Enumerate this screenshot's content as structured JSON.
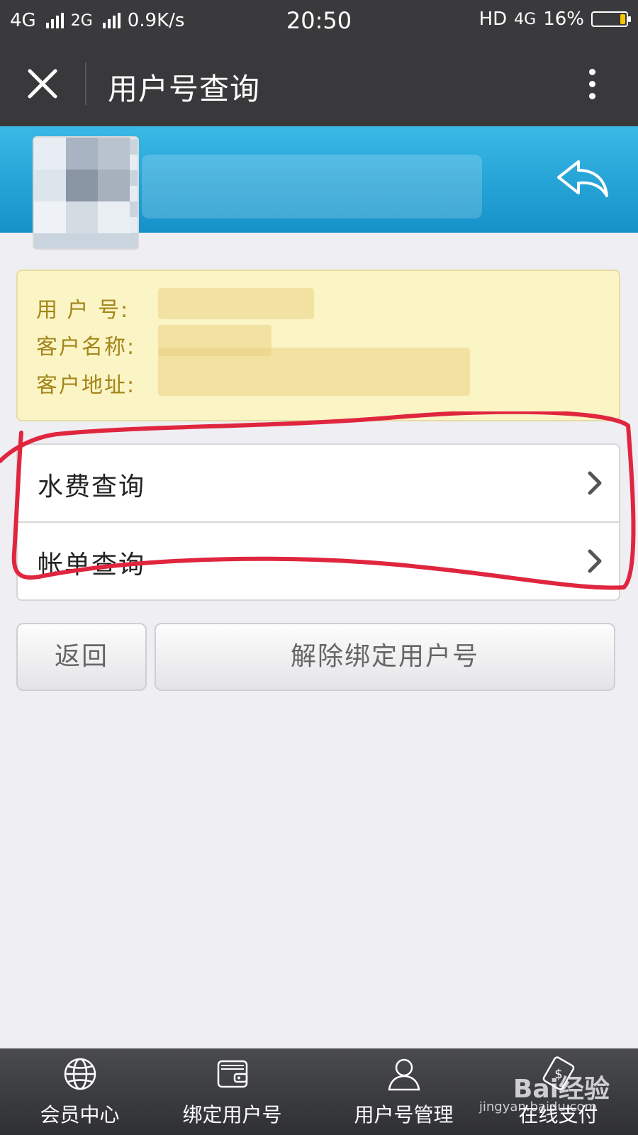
{
  "status_bar": {
    "network1": "4G",
    "network2": "2G",
    "speed": "0.9K/s",
    "time": "20:50",
    "hd": "HD",
    "network3": "4G",
    "battery": "16%",
    "battery_level": 0.16
  },
  "header": {
    "title": "用户号查询"
  },
  "info": {
    "user_no_label": "用 户 号:",
    "customer_name_label": "客户名称:",
    "customer_address_label": "客户地址:"
  },
  "menu": {
    "items": [
      {
        "label": "水费查询"
      },
      {
        "label": "帐单查询"
      }
    ]
  },
  "buttons": {
    "back": "返回",
    "unbind": "解除绑定用户号"
  },
  "tabs": [
    {
      "label": "会员中心",
      "icon": "globe-icon"
    },
    {
      "label": "绑定用户号",
      "icon": "wallet-icon"
    },
    {
      "label": "用户号管理",
      "icon": "user-icon"
    },
    {
      "label": "在线支付",
      "icon": "payment-icon"
    }
  ],
  "watermark": {
    "text": "Bai经验",
    "sub": "jingyan.baidu.com"
  },
  "colors": {
    "header_bg": "#39393b",
    "banner": "#1a9bd3",
    "info_bg": "#fbf4c5",
    "info_label": "#a3861a",
    "annotation": "#e0263f",
    "battery": "#f4c400"
  }
}
